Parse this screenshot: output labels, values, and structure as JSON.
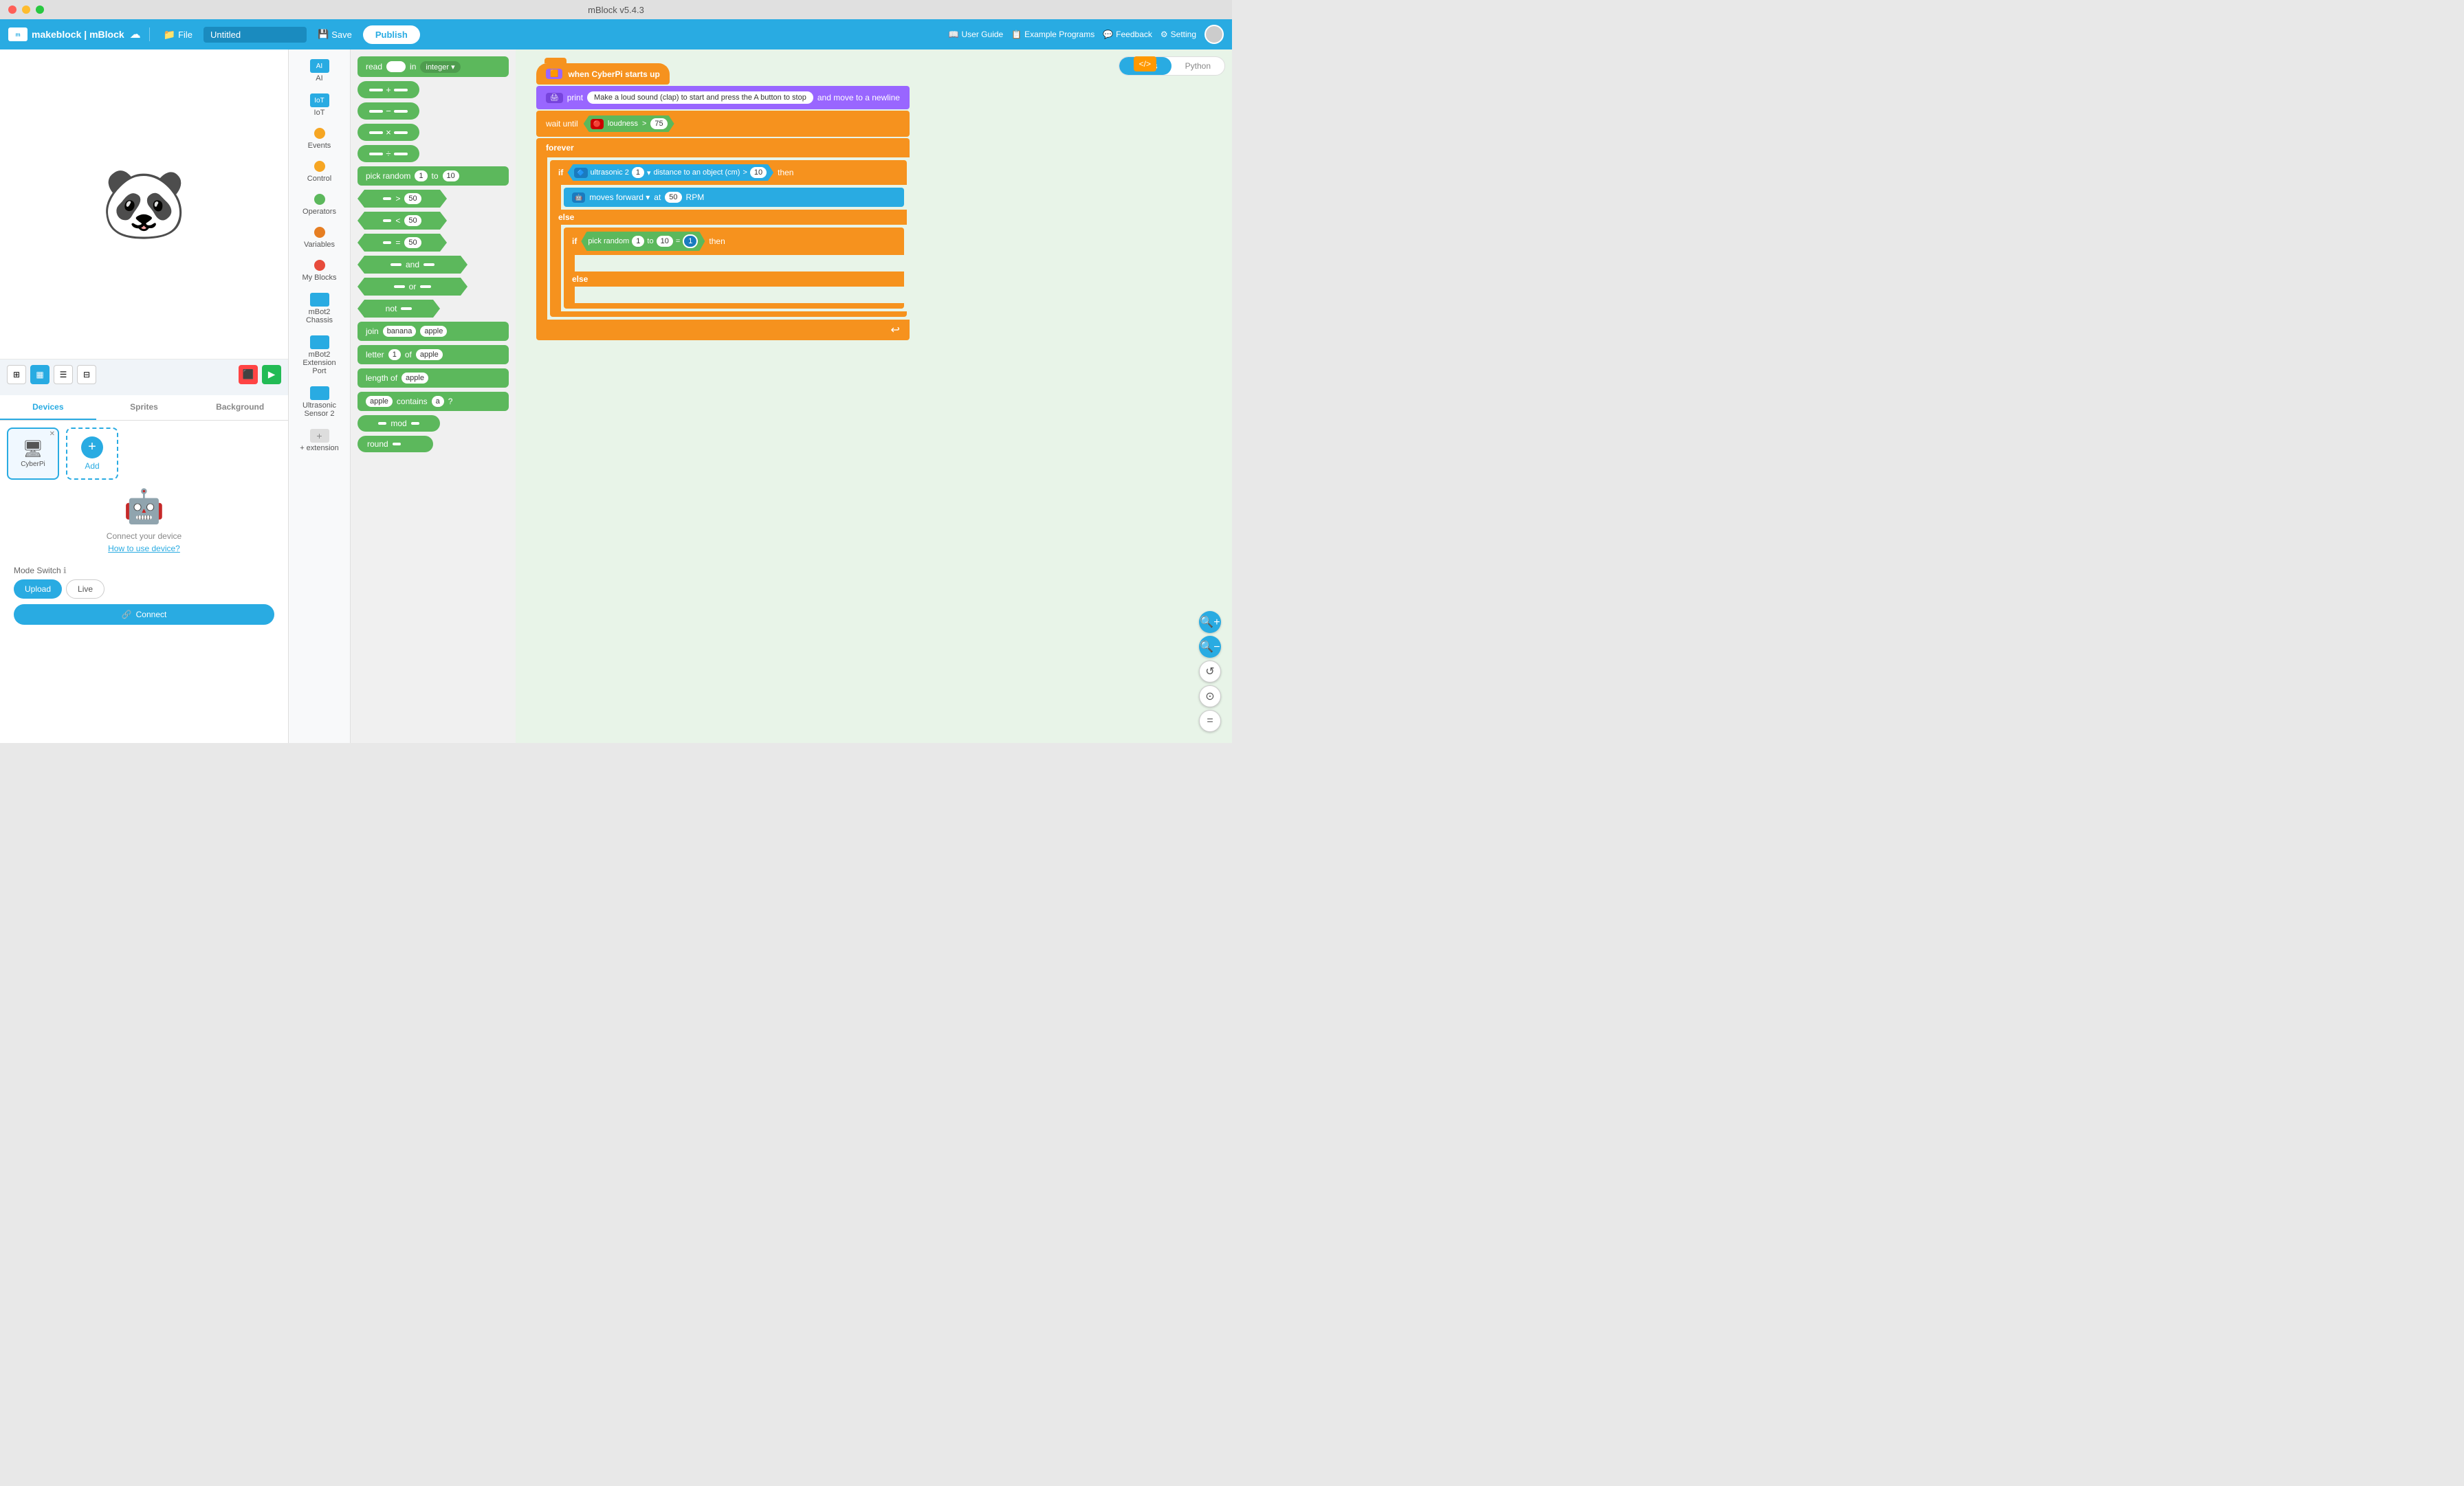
{
  "titleBar": {
    "title": "mBlock v5.4.3"
  },
  "menuBar": {
    "brand": "makeblock | mBlock",
    "fileLabel": "File",
    "projectName": "Untitled",
    "saveLabel": "Save",
    "publishLabel": "Publish",
    "userGuide": "User Guide",
    "examplePrograms": "Example Programs",
    "feedback": "Feedback",
    "setting": "Setting"
  },
  "stage": {
    "panda": "🐼"
  },
  "viewButtons": [
    {
      "id": "stage-view",
      "icon": "⊞",
      "active": false
    },
    {
      "id": "block-view",
      "icon": "▦",
      "active": true
    },
    {
      "id": "list-view",
      "icon": "☰",
      "active": false
    },
    {
      "id": "grid-view",
      "icon": "⊟",
      "active": false
    }
  ],
  "tabs": {
    "devices": "Devices",
    "sprites": "Sprites",
    "background": "Background"
  },
  "devicePanel": {
    "deviceName": "CyberPi",
    "addLabel": "Add",
    "connectText": "Connect your device",
    "howToLink": "How to use device?",
    "modeSwitch": "Mode Switch",
    "uploadLabel": "Upload",
    "liveLabel": "Live",
    "connectLabel": "Connect"
  },
  "categories": [
    {
      "id": "ai",
      "label": "AI",
      "color": "#29abe2",
      "icon": "🤖"
    },
    {
      "id": "iot",
      "label": "IoT",
      "color": "#29abe2",
      "icon": "📡"
    },
    {
      "id": "events",
      "label": "Events",
      "color": "#f6a623",
      "icon": "⚡"
    },
    {
      "id": "control",
      "label": "Control",
      "color": "#f6a623",
      "icon": "⚙"
    },
    {
      "id": "operators",
      "label": "Operators",
      "color": "#5cb85c",
      "icon": "➕"
    },
    {
      "id": "variables",
      "label": "Variables",
      "color": "#e67e22",
      "icon": "🔶"
    },
    {
      "id": "my-blocks",
      "label": "My Blocks",
      "color": "#e74c3c",
      "icon": "🧱"
    },
    {
      "id": "mbot2-chassis",
      "label": "mBot2 Chassis",
      "color": "#29abe2",
      "icon": "🤖"
    },
    {
      "id": "mbot2-ext",
      "label": "mBot2 Extension Port",
      "color": "#29abe2",
      "icon": "🔌"
    },
    {
      "id": "ultrasonic",
      "label": "Ultrasonic Sensor 2",
      "color": "#29abe2",
      "icon": "📻"
    },
    {
      "id": "extension",
      "label": "+ extension",
      "color": "#888",
      "icon": "➕"
    }
  ],
  "blocks": [
    {
      "id": "read-block",
      "type": "read",
      "label": "read",
      "extra": "in  integer ▾"
    },
    {
      "id": "add-block",
      "type": "operator",
      "symbol": "+"
    },
    {
      "id": "sub-block",
      "type": "operator",
      "symbol": "-"
    },
    {
      "id": "mul-block",
      "type": "operator",
      "symbol": "*"
    },
    {
      "id": "div-block",
      "type": "operator",
      "symbol": "/"
    },
    {
      "id": "pick-random",
      "type": "pick-random",
      "label": "pick random",
      "from": "1",
      "to": "10"
    },
    {
      "id": "gt-block",
      "type": "compare",
      "symbol": ">",
      "val": "50"
    },
    {
      "id": "lt-block",
      "type": "compare",
      "symbol": "<",
      "val": "50"
    },
    {
      "id": "eq-block",
      "type": "compare",
      "symbol": "=",
      "val": "50"
    },
    {
      "id": "and-block",
      "type": "logic",
      "label": "and"
    },
    {
      "id": "or-block",
      "type": "logic",
      "label": "or"
    },
    {
      "id": "not-block",
      "type": "logic",
      "label": "not"
    },
    {
      "id": "join-block",
      "type": "string",
      "label": "join",
      "a": "banana",
      "b": "apple"
    },
    {
      "id": "letter-block",
      "type": "string",
      "label": "letter",
      "n": "1",
      "of": "of",
      "str": "apple"
    },
    {
      "id": "length-block",
      "type": "string",
      "label": "length of",
      "str": "apple"
    },
    {
      "id": "contains-block",
      "type": "string",
      "label": "contains",
      "a": "apple",
      "b": "a"
    },
    {
      "id": "mod-block",
      "type": "operator",
      "symbol": "mod"
    },
    {
      "id": "round-block",
      "type": "round",
      "label": "round"
    }
  ],
  "codeTabs": {
    "blocks": "Blocks",
    "python": "Python",
    "active": "blocks"
  },
  "codeBlocks": {
    "whenStarts": "when CyberPi starts up",
    "printText": "Make a loud sound (clap) to start and press the A button to stop",
    "printExtra": "and move to a newline",
    "waitUntil": "wait until",
    "loudness": "loudness",
    "loudnessVal": "75",
    "forever": "forever",
    "if1": "if",
    "ultrasonic": "ultrasonic 2",
    "ultra1": "1",
    "ultraDir": "▾",
    "distanceText": "distance to an object (cm)",
    "gt": ">",
    "distVal": "10",
    "then": "then",
    "movesForward": "moves forward ▾",
    "at": "at",
    "rpmVal": "50",
    "rpm": "RPM",
    "else1": "else",
    "if2": "if",
    "pickRandom": "pick random",
    "pr1": "1",
    "to": "to",
    "pr10": "10",
    "eq": "=",
    "eqVal": "1",
    "then2": "then",
    "else2": "else"
  },
  "zoomButtons": {
    "zoomIn": "+",
    "zoomOut": "−",
    "refresh": "↺",
    "center": "⊙",
    "equals": "="
  }
}
